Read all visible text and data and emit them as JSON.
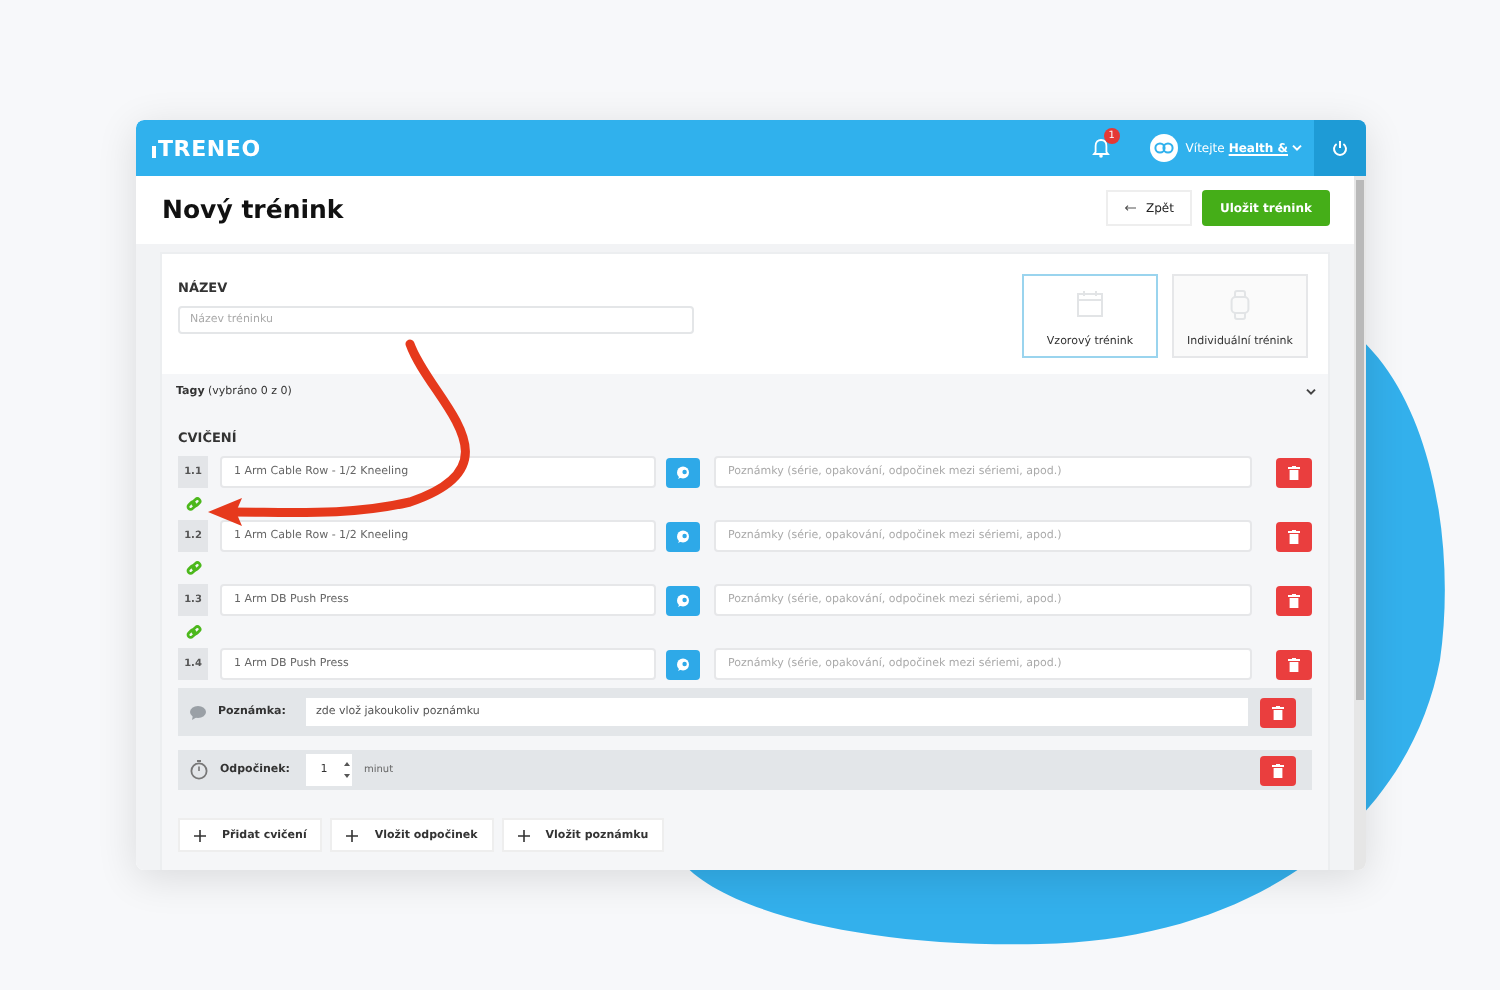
{
  "header": {
    "logo": "TRENEO",
    "notification_count": "1",
    "greeting": "Vítejte",
    "user_name": "Health &"
  },
  "page": {
    "title": "Nový trénink",
    "back_button": "Zpět",
    "save_button": "Uložit trénink"
  },
  "form": {
    "name_label": "NÁZEV",
    "name_placeholder": "Název tréninku",
    "tags_label": "Tagy",
    "tags_count": "(vybráno 0 z 0)",
    "exercises_heading": "CVIČENÍ"
  },
  "templates": [
    {
      "label": "Vzorový trénink",
      "selected": true
    },
    {
      "label": "Individuální trénink",
      "selected": false
    }
  ],
  "items": [
    {
      "kind": "exercise",
      "number": "1.1",
      "name": "1 Arm Cable Row - 1/2 Kneeling",
      "notes_placeholder": "Poznámky (série, opakování, odpočinek mezi sériemi, apod.)",
      "linked": true
    },
    {
      "kind": "exercise",
      "number": "1.2",
      "name": "1 Arm Cable Row - 1/2 Kneeling",
      "notes_placeholder": "Poznámky (série, opakování, odpočinek mezi sériemi, apod.)",
      "linked": true
    },
    {
      "kind": "exercise",
      "number": "1.3",
      "name": "1 Arm DB Push Press",
      "notes_placeholder": "Poznámky (série, opakování, odpočinek mezi sériemi, apod.)",
      "linked": true
    },
    {
      "kind": "exercise",
      "number": "1.4",
      "name": "1 Arm DB Push Press",
      "notes_placeholder": "Poznámky (série, opakování, odpočinek mezi sériemi, apod.)",
      "linked": false
    },
    {
      "kind": "note",
      "label": "Poznámka:",
      "value": "zde vlož jakoukoliv poznámku"
    },
    {
      "kind": "rest",
      "label": "Odpočinek:",
      "value": "1",
      "unit": "minut"
    }
  ],
  "add_buttons": [
    "Přidat cvičení",
    "Vložit odpočinek",
    "Vložit poznámku"
  ]
}
